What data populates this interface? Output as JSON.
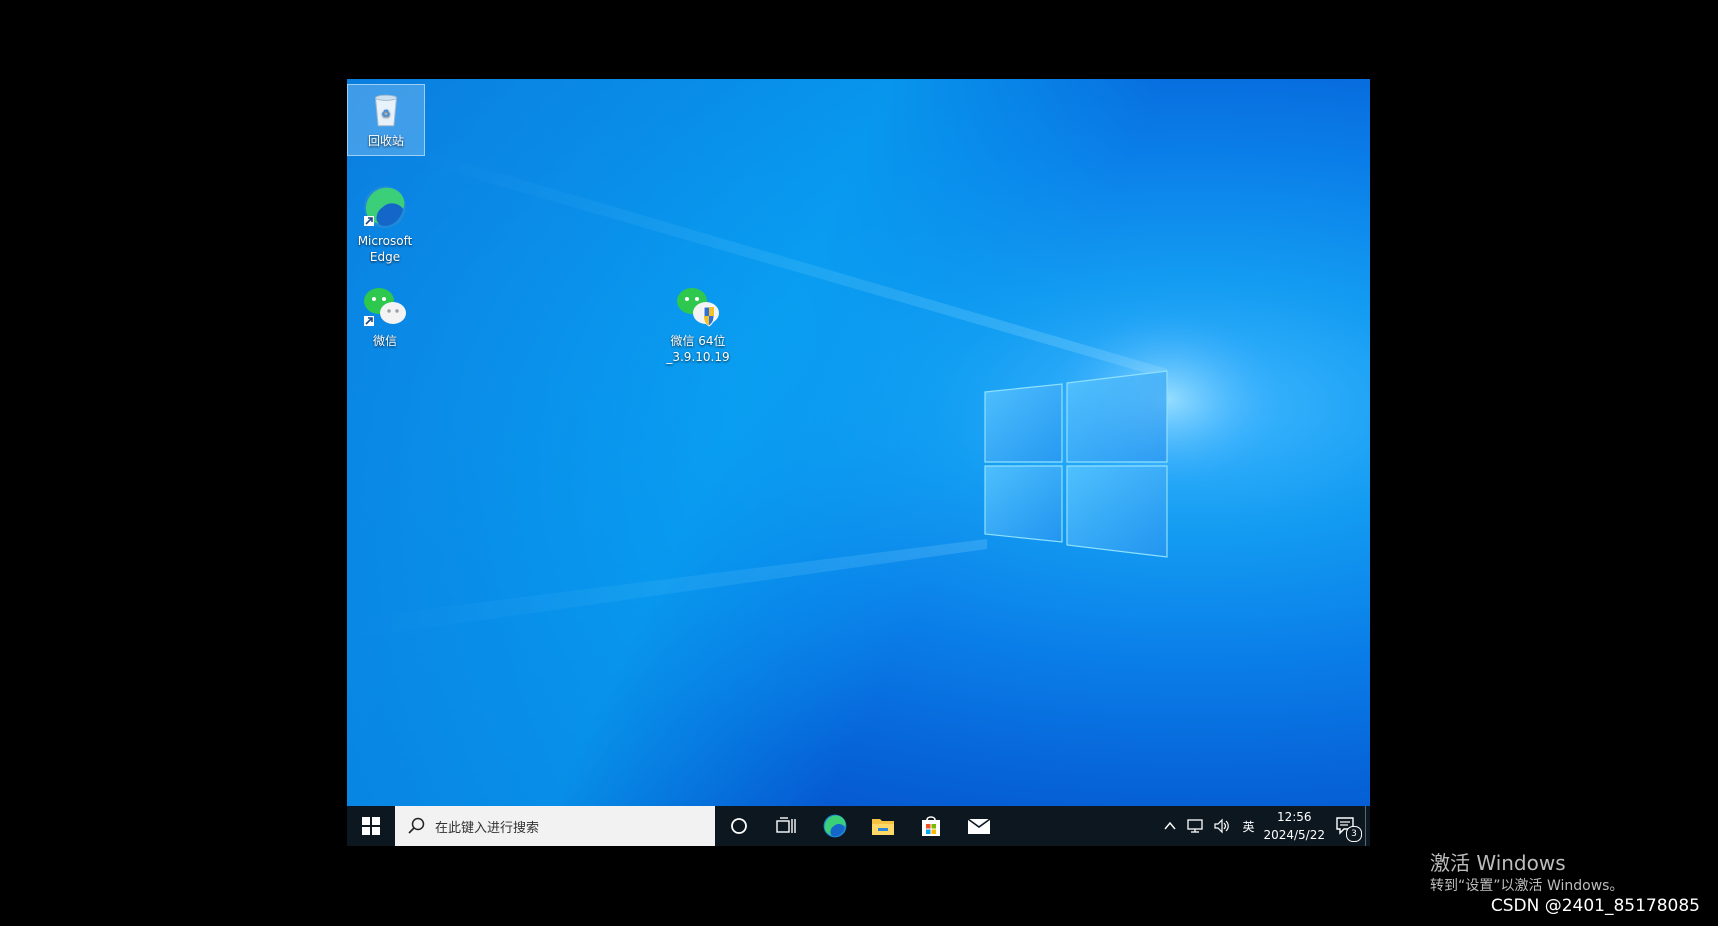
{
  "desktop": {
    "icons": [
      {
        "label": "回收站",
        "icon": "recycle-bin-icon"
      },
      {
        "label": "Microsoft Edge",
        "icon": "edge-icon"
      },
      {
        "label": "微信",
        "icon": "wechat-icon"
      },
      {
        "label": "微信 64位 _3.9.10.19",
        "icon": "wechat-installer-icon"
      }
    ]
  },
  "taskbar": {
    "search_placeholder": "在此键入进行搜索",
    "pinned": [
      "start-icon",
      "search-icon",
      "cortana-icon",
      "task-view-icon",
      "edge-icon",
      "file-explorer-icon",
      "store-icon",
      "mail-icon"
    ],
    "tray": {
      "language": "英",
      "time": "12:56",
      "date": "2024/5/22",
      "notification_count": "3"
    }
  },
  "overlay": {
    "activation_title": "激活 Windows",
    "activation_sub": "转到“设置”以激活 Windows。",
    "watermark": "CSDN @2401_85178085"
  },
  "colors": {
    "desktop_blue": "#0a7ee8",
    "taskbar": "#0c1720"
  }
}
